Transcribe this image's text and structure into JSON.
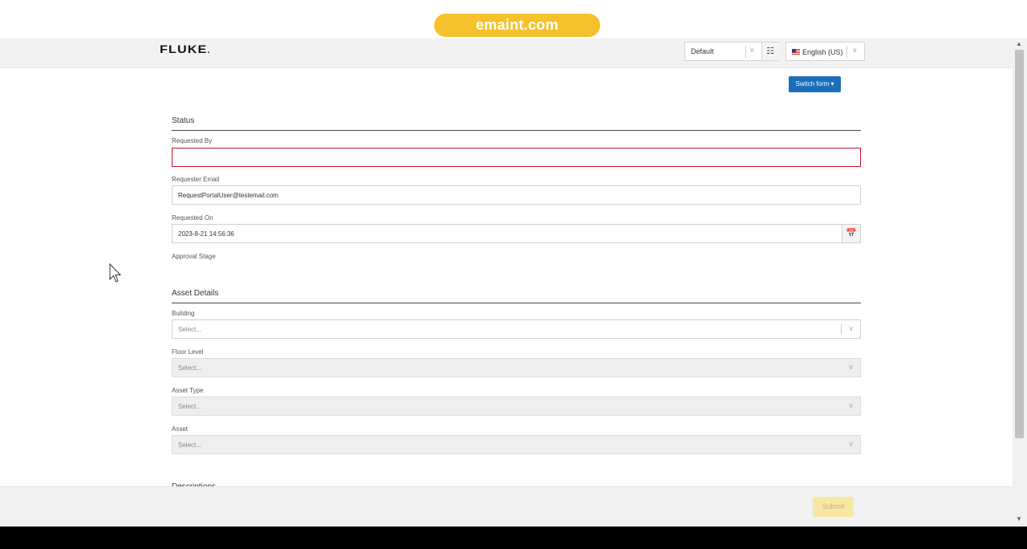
{
  "browser": {
    "url": "emaint.com"
  },
  "header": {
    "logo": "FLUKE",
    "site_selector": {
      "value": "Default",
      "icon": "org-tree-icon"
    },
    "language_selector": {
      "value": "English (US)",
      "flag": "us-flag-icon"
    }
  },
  "toolbar": {
    "switch_form_label": "Switch form ▾"
  },
  "status_section": {
    "title": "Status",
    "requested_by": {
      "label": "Requested By",
      "value": ""
    },
    "requester_email": {
      "label": "Requester Email",
      "value": "RequestPortalUser@testemail.com"
    },
    "requested_on": {
      "label": "Requested On",
      "value": "2023-8-21 14:56:36",
      "icon": "calendar-clock-icon"
    },
    "approval_stage": {
      "label": "Approval Stage"
    }
  },
  "asset_section": {
    "title": "Asset Details",
    "building": {
      "label": "Building",
      "placeholder": "Select..."
    },
    "floor_level": {
      "label": "Floor Level",
      "placeholder": "Select..."
    },
    "asset_type": {
      "label": "Asset Type",
      "placeholder": "Select..."
    },
    "asset": {
      "label": "Asset",
      "placeholder": "Select..."
    }
  },
  "next_section": {
    "title": "Descriptions"
  },
  "footer": {
    "submit_label": "Submit"
  },
  "colors": {
    "brand_yellow": "#f6c22b",
    "primary_blue": "#1a6fb8",
    "error_red": "#c8102e"
  }
}
